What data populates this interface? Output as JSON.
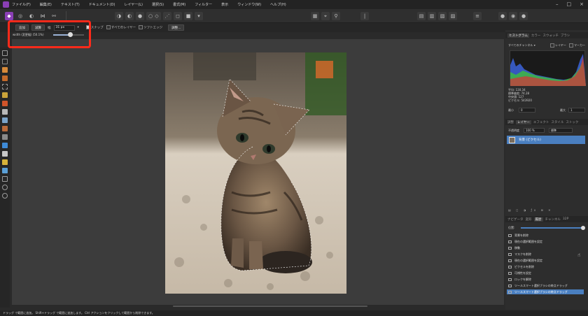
{
  "menubar": {
    "items": [
      "ファイル(F)",
      "編集(E)",
      "テキスト(T)",
      "ドキュメント(D)",
      "レイヤー(L)",
      "選択(S)",
      "書式(M)",
      "フィルター",
      "表示",
      "ウィンドウ(W)",
      "ヘルプ(H)"
    ]
  },
  "context": {
    "add_label": "追加",
    "subtract_label": "減算",
    "width_label": "幅",
    "width_value": "31 px",
    "snap_label": "スナップ",
    "all_layers_label": "すべてのレイヤー",
    "soft_edges_label": "ソフトエッジ",
    "adjust_button": "調整...",
    "subline_text": "width (変更幅) (50.1%)",
    "slider_value": 0.55
  },
  "panel": {
    "top_tabs": [
      "ヒストグラム",
      "カラー",
      "スウォッチ",
      "ブラシ"
    ],
    "channel_select": "すべてのチャンネル",
    "layer_opt": "レイヤー",
    "marker_opt": "マーカー",
    "stats": [
      "平均: 130.34",
      "標準偏差: 74.28",
      "中央値: 127",
      "ピクセル: 543920"
    ],
    "min_label": "最小",
    "min_value": "0",
    "max_label": "最大",
    "max_value": "1",
    "layer_tabs": [
      "調整",
      "レイヤー",
      "エフェクト",
      "スタイル",
      "ストック"
    ],
    "opacity_label": "不透明度",
    "opacity_value": "100 %",
    "blend_mode": "標準",
    "layer_name": "背景 (ピクセル)",
    "history_tabs": [
      "ナビゲータ",
      "変形",
      "履歴",
      "チャンネル",
      "32P"
    ],
    "history_label": "位置:",
    "history_items": [
      "背景を削除",
      "現在の選択範囲を設定",
      "移動",
      "マスクを削除",
      "現在の選択範囲を設定",
      "ピクセルを削除",
      "可視性を設定",
      "ロックを解除",
      "ツールスマート選択ブラシの終点ドラッグ",
      "ツールスマート選択ブラシの終点ドラッグ"
    ]
  },
  "status": {
    "text": "ドラッグ で範囲に追加。 Shift+ドラッグ で範囲に追加します。 Ctrl アクションをクリックして範囲から削除できます。"
  }
}
